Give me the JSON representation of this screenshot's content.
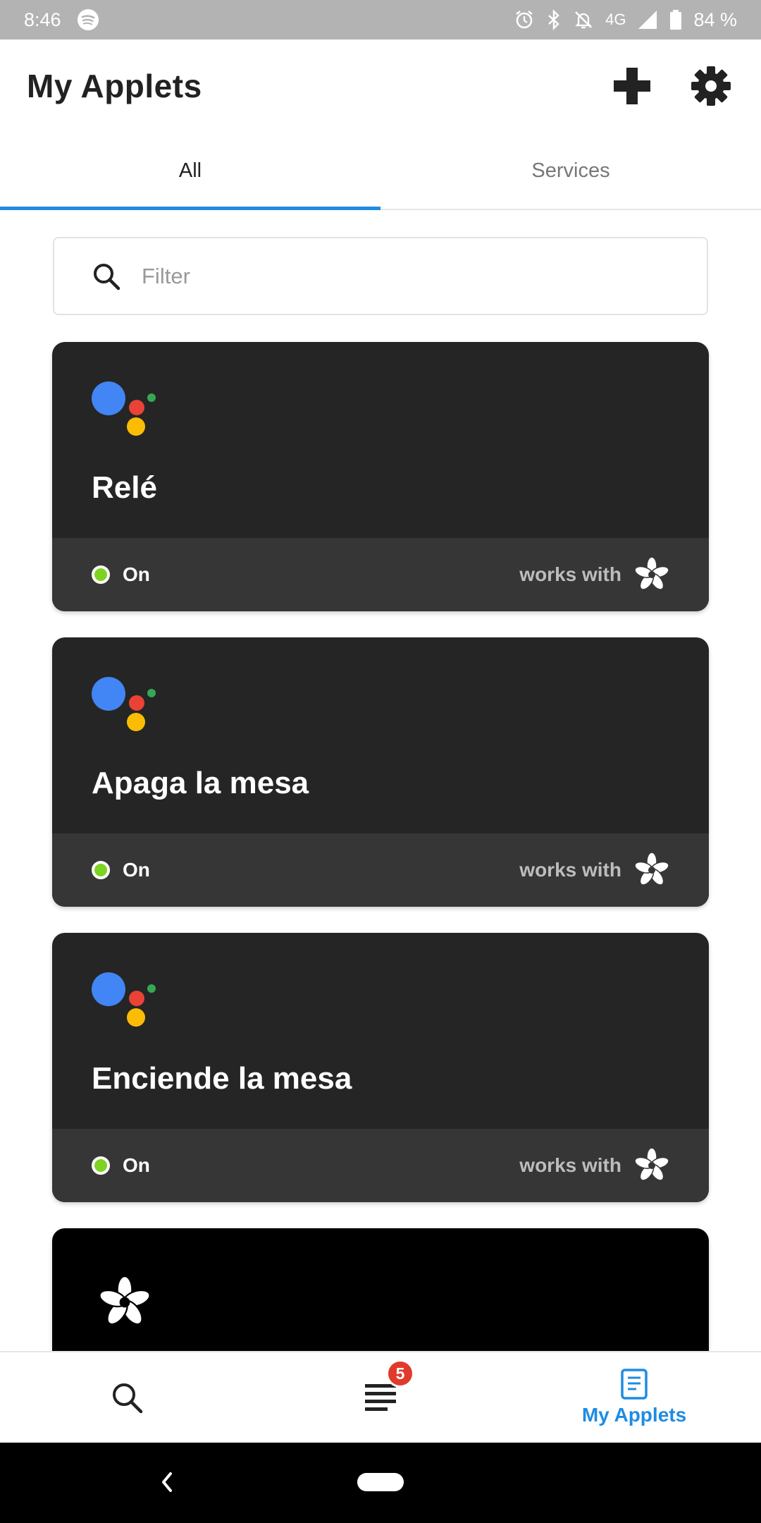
{
  "status_bar": {
    "time": "8:46",
    "network": "4G",
    "battery": "84 %"
  },
  "header": {
    "title": "My Applets",
    "add_icon": "plus-icon",
    "settings_icon": "gear-icon"
  },
  "tabs": [
    {
      "label": "All",
      "active": true
    },
    {
      "label": "Services",
      "active": false
    }
  ],
  "filter": {
    "placeholder": "Filter",
    "value": ""
  },
  "applets": [
    {
      "title": "Relé",
      "status": "On",
      "works_with": "works with",
      "service_icon": "google-assistant-icon",
      "partner_icon": "adafruit-flower-icon"
    },
    {
      "title": "Apaga la mesa",
      "status": "On",
      "works_with": "works with",
      "service_icon": "google-assistant-icon",
      "partner_icon": "adafruit-flower-icon"
    },
    {
      "title": "Enciende la mesa",
      "status": "On",
      "works_with": "works with",
      "service_icon": "google-assistant-icon",
      "partner_icon": "adafruit-flower-icon"
    }
  ],
  "bottom_nav": {
    "search_icon": "search-icon",
    "feed_icon": "list-icon",
    "feed_badge": "5",
    "my_applets_label": "My Applets"
  },
  "colors": {
    "accent": "#1e8ce3",
    "status_on": "#7ed321",
    "badge": "#e03a2c",
    "card_bg": "#252525",
    "card_footer": "#363636"
  }
}
